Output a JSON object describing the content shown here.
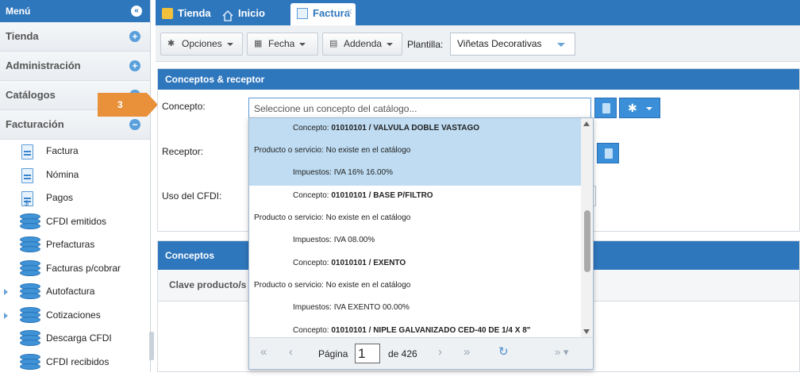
{
  "sidebar": {
    "title": "Menú",
    "sections": [
      {
        "label": "Tienda"
      },
      {
        "label": "Administración"
      },
      {
        "label": "Catálogos"
      },
      {
        "label": "Facturación"
      }
    ],
    "items": [
      {
        "label": "Factura",
        "icon": "document-icon"
      },
      {
        "label": "Nómina",
        "icon": "document-icon"
      },
      {
        "label": "Pagos",
        "icon": "payment-document-icon"
      },
      {
        "label": "CFDI emitidos",
        "icon": "database-icon"
      },
      {
        "label": "Prefacturas",
        "icon": "database-icon"
      },
      {
        "label": "Facturas p/cobrar",
        "icon": "database-icon"
      },
      {
        "label": "Autofactura",
        "icon": "database-icon"
      },
      {
        "label": "Cotizaciones",
        "icon": "database-icon"
      },
      {
        "label": "Descarga CFDI",
        "icon": "database-icon"
      },
      {
        "label": "CFDI recibidos",
        "icon": "database-icon"
      }
    ]
  },
  "tabs": [
    {
      "label": "Tienda"
    },
    {
      "label": "Inicio"
    },
    {
      "label": "Factura"
    }
  ],
  "toolbar": {
    "opciones": "Opciones",
    "fecha": "Fecha",
    "addenda": "Addenda",
    "plantilla_label": "Plantilla:",
    "plantilla_value": "Viñetas Decorativas"
  },
  "step_badge": "3",
  "panel": {
    "title": "Conceptos & receptor",
    "concepto_label": "Concepto:",
    "concepto_placeholder": "Seleccione un concepto del catálogo...",
    "receptor_label": "Receptor:",
    "uso_label": "Uso del CFDI:"
  },
  "dropdown": {
    "concepto_prefix": "Concepto:",
    "producto_prefix": "Producto o servicio:",
    "impuestos_prefix": "Impuestos:",
    "options": [
      {
        "concepto": "01010101 / VALVULA DOBLE VASTAGO",
        "producto": "No existe en el catálogo",
        "impuestos": "IVA 16% 16.00%"
      },
      {
        "concepto": "01010101 / BASE P/FILTRO",
        "producto": "No existe en el catálogo",
        "impuestos": "IVA 08.00%"
      },
      {
        "concepto": "01010101 / EXENTO",
        "producto": "No existe en el catálogo",
        "impuestos": "IVA EXENTO 00.00%"
      },
      {
        "concepto": "01010101 / NIPLE GALVANIZADO CED-40 DE 1/4 X 8\""
      }
    ],
    "pager": {
      "page_label": "Página",
      "page_value": "1",
      "total": "de 426"
    }
  },
  "conceptos": {
    "title": "Conceptos",
    "col_clave": "Clave producto/s"
  },
  "colors": {
    "brand": "#2f77bd",
    "highlight": "#bfdcf2",
    "badge": "#e8913a"
  }
}
